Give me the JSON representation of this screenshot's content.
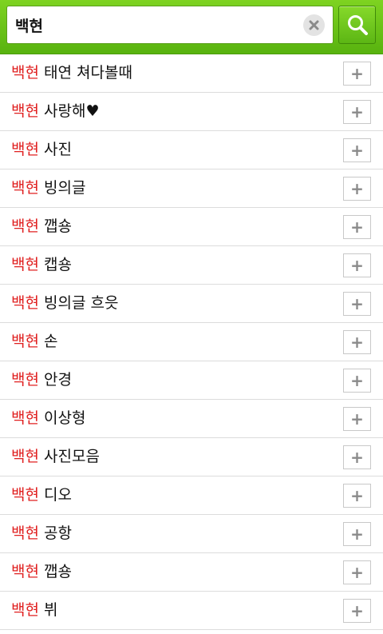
{
  "search": {
    "value": "백현"
  },
  "colors": {
    "accent": "#6cc41c",
    "keyword": "#e02020"
  },
  "add_label": "+",
  "suggestions": [
    {
      "keyword": "백현",
      "rest": " 태연 쳐다볼때"
    },
    {
      "keyword": "백현",
      "rest": " 사랑해♥"
    },
    {
      "keyword": "백현",
      "rest": " 사진"
    },
    {
      "keyword": "백현",
      "rest": " 빙의글"
    },
    {
      "keyword": "백현",
      "rest": " 깹숑"
    },
    {
      "keyword": "백현",
      "rest": " 캡숑"
    },
    {
      "keyword": "백현",
      "rest": " 빙의글 흐읏"
    },
    {
      "keyword": "백현",
      "rest": " 손"
    },
    {
      "keyword": "백현",
      "rest": " 안경"
    },
    {
      "keyword": "백현",
      "rest": " 이상형"
    },
    {
      "keyword": "백현",
      "rest": " 사진모음"
    },
    {
      "keyword": "백현",
      "rest": " 디오"
    },
    {
      "keyword": "백현",
      "rest": " 공항"
    },
    {
      "keyword": "백현",
      "rest": " 깹숑"
    },
    {
      "keyword": "백현",
      "rest": " 뷔"
    }
  ]
}
